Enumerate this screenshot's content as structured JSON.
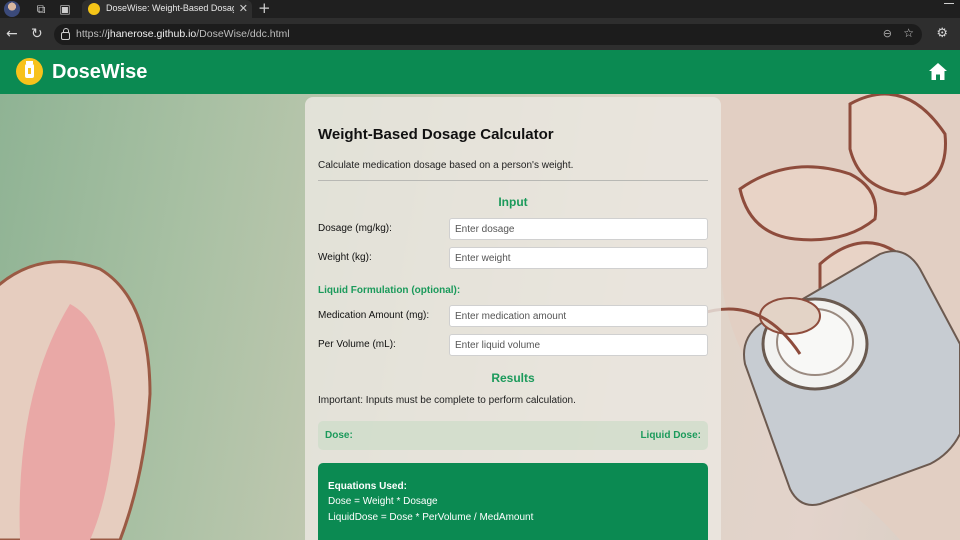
{
  "browser": {
    "tab_title": "DoseWise: Weight-Based Dosage",
    "url_prefix": "https://",
    "url_host": "jhanerose.github.io",
    "url_path": "/DoseWise/ddc.html"
  },
  "header": {
    "brand": "DoseWise",
    "home_icon": "home-icon",
    "accent_color": "#0b8a52"
  },
  "calculator": {
    "title": "Weight-Based Dosage Calculator",
    "subtitle": "Calculate medication dosage based on a person's weight.",
    "input_heading": "Input",
    "dosage_label": "Dosage (mg/kg):",
    "dosage_placeholder": "Enter dosage",
    "weight_label": "Weight (kg):",
    "weight_placeholder": "Enter weight",
    "liquid_heading": "Liquid Formulation (optional):",
    "med_amount_label": "Medication Amount (mg):",
    "med_amount_placeholder": "Enter medication amount",
    "per_volume_label": "Per Volume (mL):",
    "per_volume_placeholder": "Enter liquid volume",
    "results_heading": "Results",
    "important_note": "Important: Inputs must be complete to perform calculation.",
    "dose_label": "Dose:",
    "liquid_dose_label": "Liquid Dose:",
    "equations_heading": "Equations Used:",
    "equation_1": "Dose = Weight * Dosage",
    "equation_2": "LiquidDose = Dose * PerVolume / MedAmount"
  }
}
